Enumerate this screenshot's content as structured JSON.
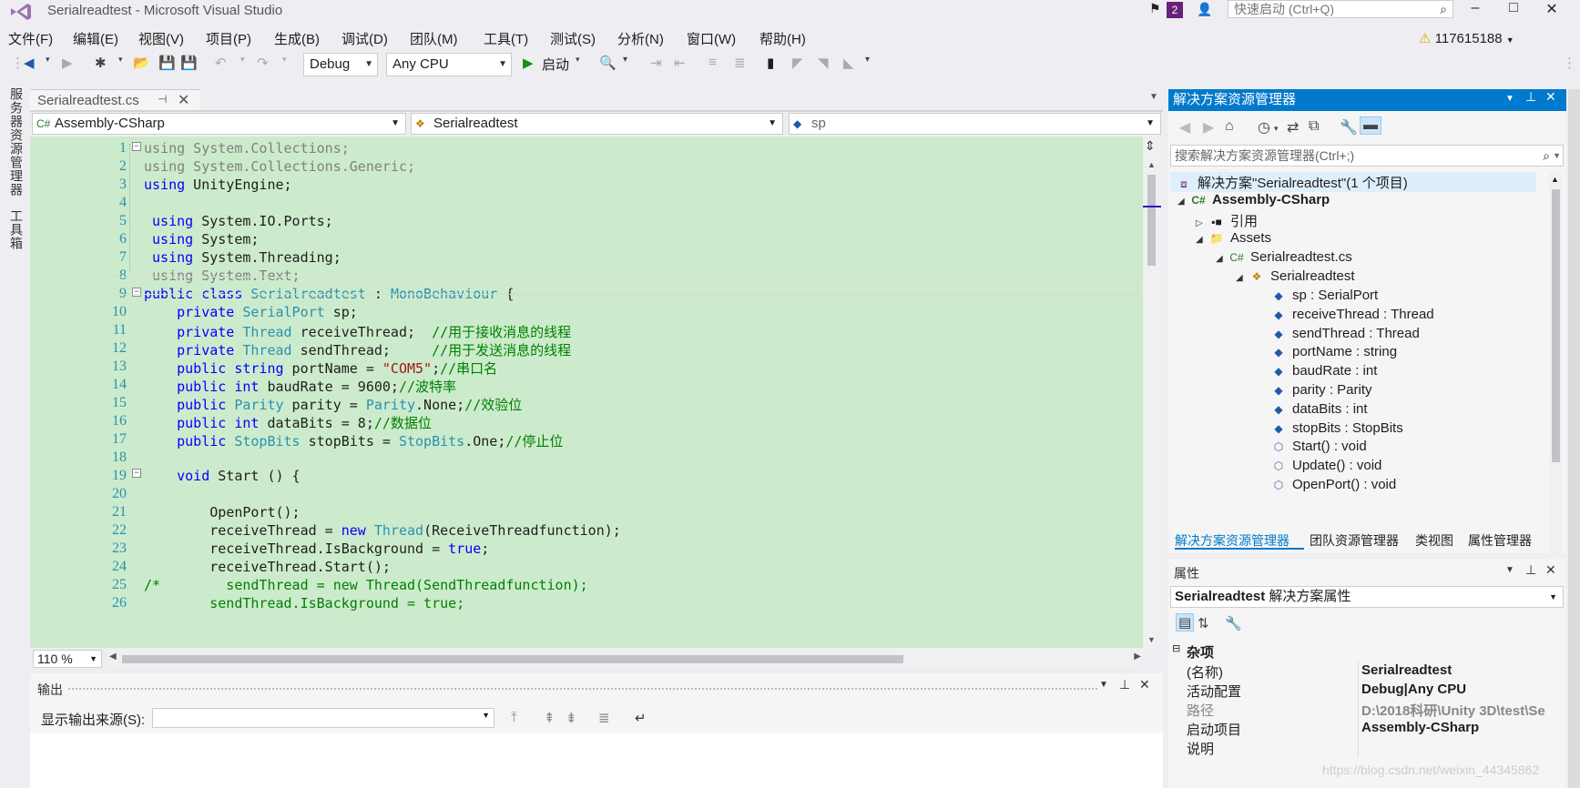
{
  "titlebar": {
    "title": "Serialreadtest - Microsoft Visual Studio",
    "notification_count": "2",
    "quick_launch_placeholder": "快速启动 (Ctrl+Q)"
  },
  "menu": [
    "文件(F)",
    "编辑(E)",
    "视图(V)",
    "项目(P)",
    "生成(B)",
    "调试(D)",
    "团队(M)",
    "工具(T)",
    "测试(S)",
    "分析(N)",
    "窗口(W)",
    "帮助(H)"
  ],
  "account": {
    "warning_count": "117615188"
  },
  "toolbar": {
    "configuration": "Debug",
    "platform": "Any CPU",
    "start_label": "启动"
  },
  "rail": {
    "server_explorer": "服务器资源管理器",
    "toolbox": "工具箱"
  },
  "editor": {
    "tab_name": "Serialreadtest.cs",
    "nav_project": "Assembly-CSharp",
    "nav_class": "Serialreadtest",
    "nav_member": "sp",
    "zoom": "110 %",
    "line_numbers": [
      "1",
      "2",
      "3",
      "4",
      "5",
      "6",
      "7",
      "8",
      "9",
      "10",
      "11",
      "12",
      "13",
      "14",
      "15",
      "16",
      "17",
      "18",
      "19",
      "20",
      "21",
      "22",
      "23",
      "24",
      "25",
      "26"
    ]
  },
  "output": {
    "title": "输出",
    "source_label": "显示输出来源(S):",
    "source_value": ""
  },
  "solution_explorer": {
    "title": "解决方案资源管理器",
    "search_placeholder": "搜索解决方案资源管理器(Ctrl+;)",
    "items": [
      {
        "label": "解决方案\"Serialreadtest\"(1 个项目)"
      },
      {
        "label": "Assembly-CSharp"
      },
      {
        "label": "引用"
      },
      {
        "label": "Assets"
      },
      {
        "label": "Serialreadtest.cs"
      },
      {
        "label": "Serialreadtest"
      },
      {
        "label": "sp : SerialPort"
      },
      {
        "label": "receiveThread : Thread"
      },
      {
        "label": "sendThread : Thread"
      },
      {
        "label": "portName : string"
      },
      {
        "label": "baudRate : int"
      },
      {
        "label": "parity : Parity"
      },
      {
        "label": "dataBits : int"
      },
      {
        "label": "stopBits : StopBits"
      },
      {
        "label": "Start() : void"
      },
      {
        "label": "Update() : void"
      },
      {
        "label": "OpenPort() : void"
      }
    ],
    "tabs": [
      "解决方案资源管理器",
      "团队资源管理器",
      "类视图",
      "属性管理器"
    ]
  },
  "properties": {
    "title": "属性",
    "object_name": "Serialreadtest",
    "object_kind": "解决方案属性",
    "category": "杂项",
    "rows": [
      {
        "key": "(名称)",
        "value": "Serialreadtest"
      },
      {
        "key": "活动配置",
        "value": "Debug|Any CPU"
      },
      {
        "key": "路径",
        "value": "D:\\2018科研\\Unity 3D\\test\\Se"
      },
      {
        "key": "启动项目",
        "value": "Assembly-CSharp"
      },
      {
        "key": "说明",
        "value": ""
      }
    ]
  },
  "watermark": "https://blog.csdn.net/weixin_44345862",
  "colors": {
    "accent": "#007acc",
    "editor_bg": "#ccebcc",
    "keyword": "#0000ff",
    "type": "#2b91af",
    "comment": "#008000",
    "string": "#a31515"
  }
}
